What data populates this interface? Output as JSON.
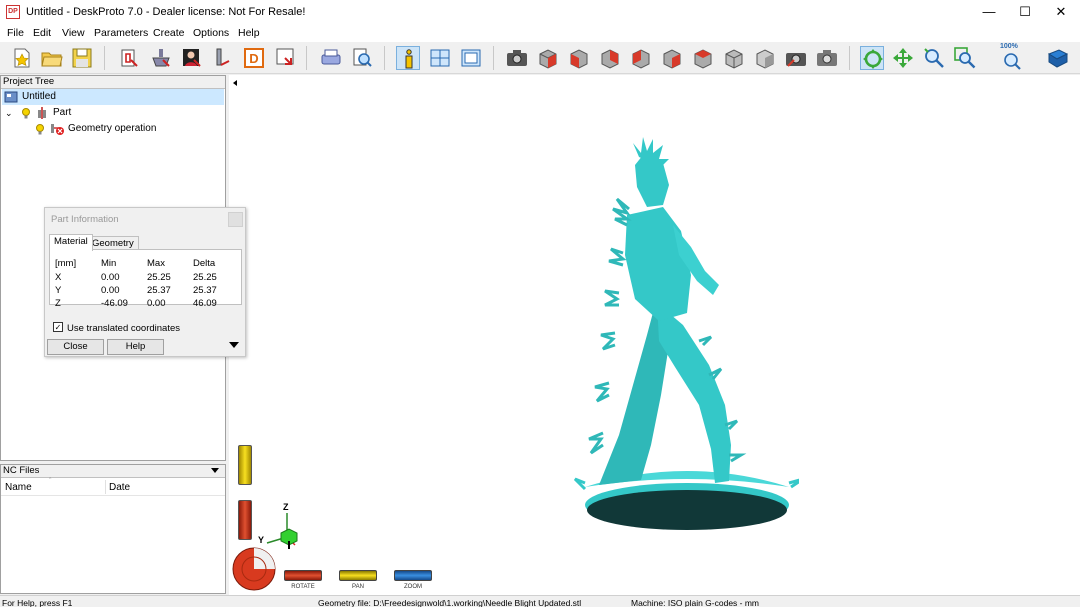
{
  "window": {
    "logo": "DP",
    "title": "Untitled - DeskProto 7.0 - Dealer license: Not For Resale!",
    "minimize": "—",
    "maximize": "☐",
    "close": "✕"
  },
  "menu": [
    "File",
    "Edit",
    "View",
    "Parameters",
    "Create",
    "Options",
    "Help"
  ],
  "toolbar": {
    "zoom_label": "100%"
  },
  "project_tree": {
    "header": "Project Tree",
    "root": "Untitled",
    "part": "Part",
    "operation": "Geometry operation"
  },
  "nc_files": {
    "header": "NC Files",
    "columns": [
      "Name",
      "Date"
    ]
  },
  "part_info": {
    "title": "Part Information",
    "tabs": [
      "Material",
      "Geometry"
    ],
    "columns": [
      "[mm]",
      "Min",
      "Max",
      "Delta"
    ],
    "rows": [
      [
        "X",
        "0.00",
        "25.25",
        "25.25"
      ],
      [
        "Y",
        "0.00",
        "25.37",
        "25.37"
      ],
      [
        "Z",
        "-46.09",
        "0.00",
        "46.09"
      ]
    ],
    "checkbox_label": "Use translated coordinates",
    "checked": true,
    "close_label": "Close",
    "help_label": "Help"
  },
  "gauges": {
    "rotate": "ROTATE",
    "pan": "PAN",
    "zoom": "ZOOM"
  },
  "axes": {
    "z": "Z",
    "y": "Y"
  },
  "status": {
    "help": "For Help, press F1",
    "geometry": "Geometry file: D:\\Freedesignwold\\1.working\\Needle Blight Updated.stl",
    "machine": "Machine: ISO plain G-codes - mm"
  },
  "colors": {
    "model": "#34c8c8",
    "model_dark": "#113838",
    "selection": "#cce8ff",
    "rotate": "#d43a1f",
    "pan": "#e8d000",
    "zoom": "#2a7fd4"
  }
}
